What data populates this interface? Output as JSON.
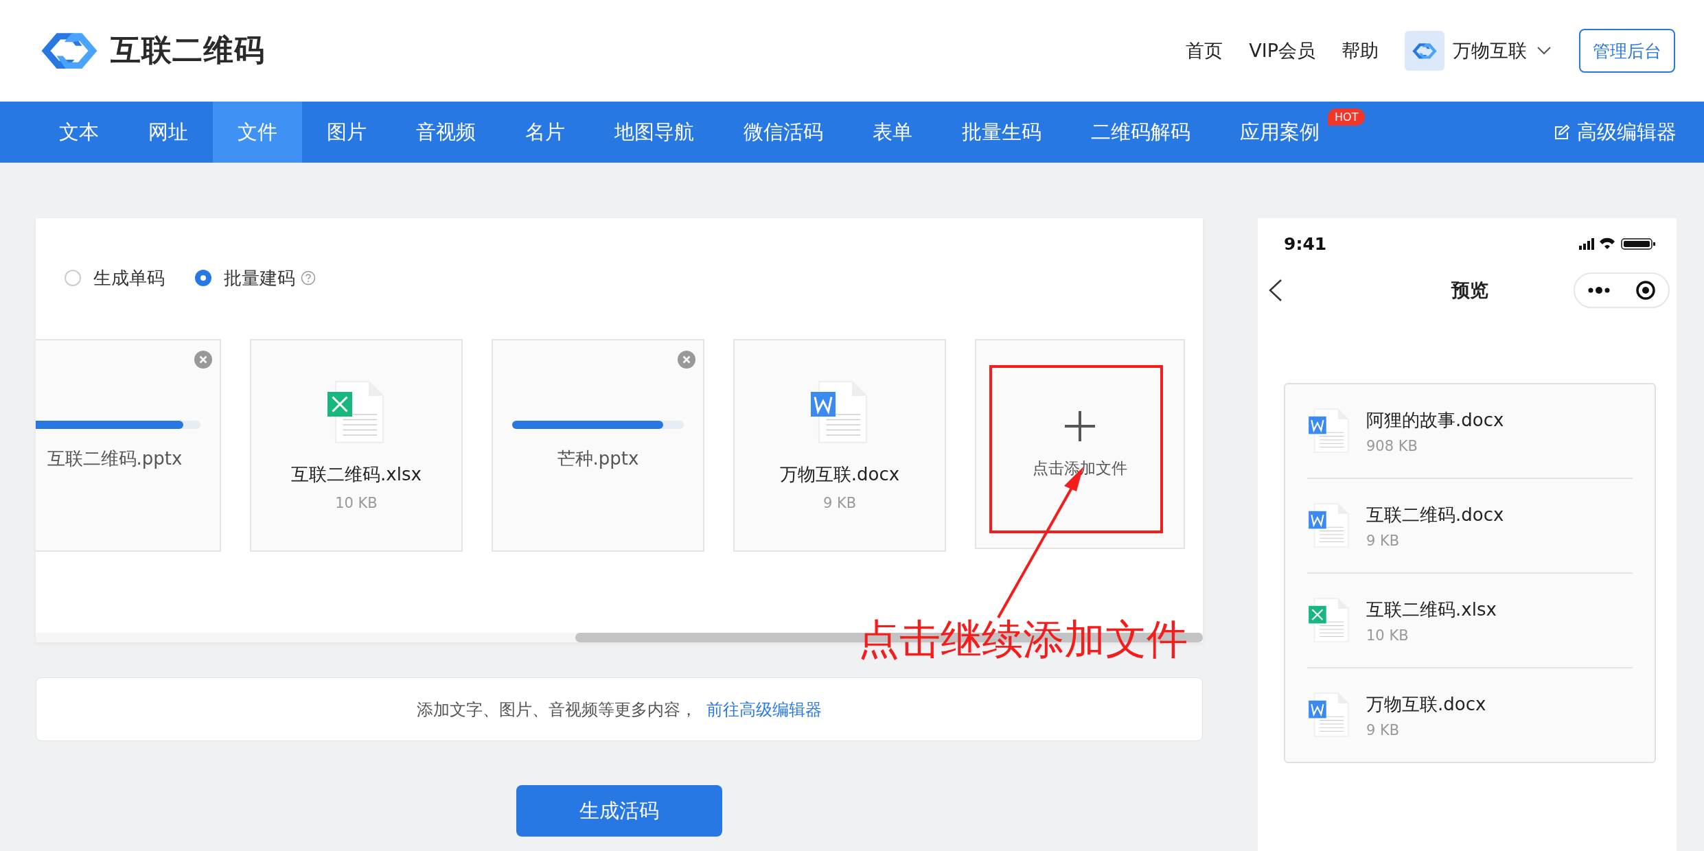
{
  "header": {
    "logo_text": "互联二维码",
    "nav_links": [
      "首页",
      "VIP会员",
      "帮助"
    ],
    "account_name": "万物互联",
    "admin_button": "管理后台"
  },
  "tabs": [
    {
      "label": "文本",
      "selected": false
    },
    {
      "label": "网址",
      "selected": false
    },
    {
      "label": "文件",
      "selected": true
    },
    {
      "label": "图片",
      "selected": false
    },
    {
      "label": "音视频",
      "selected": false
    },
    {
      "label": "名片",
      "selected": false
    },
    {
      "label": "地图导航",
      "selected": false
    },
    {
      "label": "微信活码",
      "selected": false
    },
    {
      "label": "表单",
      "selected": false
    },
    {
      "label": "批量生码",
      "selected": false
    },
    {
      "label": "二维码解码",
      "selected": false
    },
    {
      "label": "应用案例",
      "selected": false,
      "badge": "HOT"
    }
  ],
  "editor_link": "高级编辑器",
  "mode_options": [
    {
      "label": "生成单码",
      "selected": false
    },
    {
      "label": "批量建码",
      "selected": true,
      "help": true
    }
  ],
  "files": [
    {
      "kind": "uploading",
      "name": "互联二维码.pptx",
      "level": 0.9
    },
    {
      "kind": "excel",
      "name": "互联二维码.xlsx",
      "size": "10 KB"
    },
    {
      "kind": "uploading",
      "name": "芒种.pptx",
      "level": 0.88
    },
    {
      "kind": "word",
      "name": "万物互联.docx",
      "size": "9 KB"
    }
  ],
  "add_tile": {
    "label": "点击添加文件"
  },
  "annotation": {
    "text": "点击继续添加文件"
  },
  "info_bar": {
    "text": "添加文字、图片、音视频等更多内容，",
    "link": "前往高级编辑器"
  },
  "primary_button": "生成活码",
  "preview": {
    "time": "9:41",
    "title": "预览",
    "files": [
      {
        "kind": "word",
        "name": "阿狸的故事.docx",
        "size": "908 KB"
      },
      {
        "kind": "word",
        "name": "互联二维码.docx",
        "size": "9 KB"
      },
      {
        "kind": "excel",
        "name": "互联二维码.xlsx",
        "size": "10 KB"
      },
      {
        "kind": "word",
        "name": "万物互联.docx",
        "size": "9 KB"
      }
    ]
  }
}
